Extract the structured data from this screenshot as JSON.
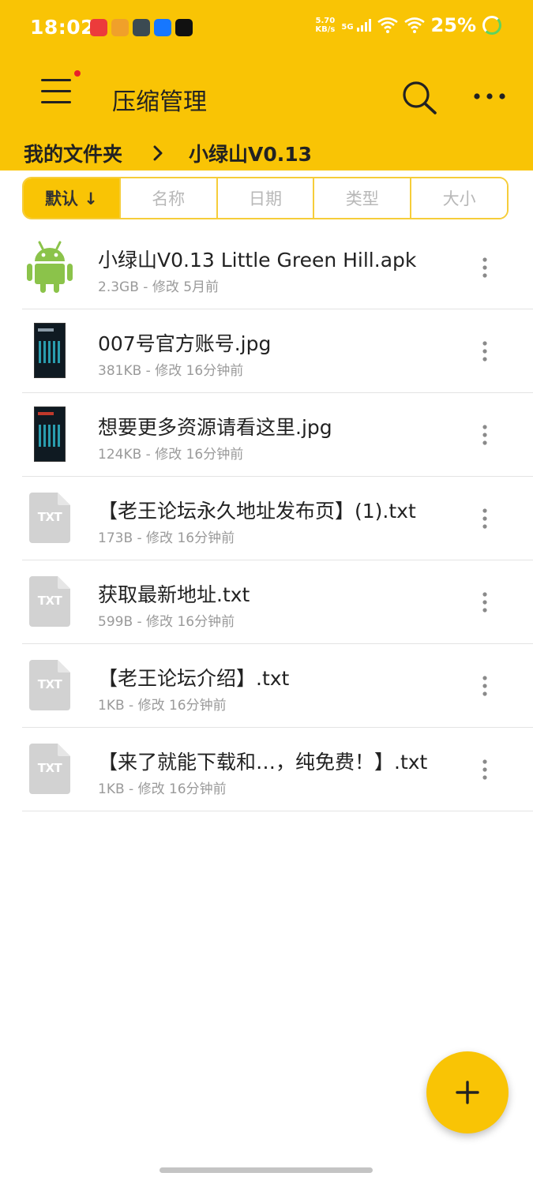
{
  "status_bar": {
    "time": "18:02",
    "net_speed_value": "5.70",
    "net_speed_unit": "KB/s",
    "network_type": "5G",
    "battery": "25%"
  },
  "app_bar": {
    "title": "压缩管理",
    "has_notification_dot": true
  },
  "breadcrumb": {
    "items": [
      "我的文件夹",
      "小绿山V0.13"
    ]
  },
  "sort_tabs": [
    {
      "label": "默认 ↓",
      "active": true
    },
    {
      "label": "名称",
      "active": false
    },
    {
      "label": "日期",
      "active": false
    },
    {
      "label": "类型",
      "active": false
    },
    {
      "label": "大小",
      "active": false
    }
  ],
  "files": [
    {
      "name": "小绿山V0.13 Little Green Hill.apk",
      "meta": "2.3GB - 修改 5月前",
      "icon": "android-icon"
    },
    {
      "name": "007号官方账号.jpg",
      "meta": "381KB - 修改 16分钟前",
      "icon": "image-thumbnail"
    },
    {
      "name": "想要更多资源请看这里.jpg",
      "meta": "124KB - 修改 16分钟前",
      "icon": "image-thumbnail"
    },
    {
      "name": "【老王论坛永久地址发布页】(1).txt",
      "meta": "173B - 修改 16分钟前",
      "icon": "txt-file-icon"
    },
    {
      "name": "获取最新地址.txt",
      "meta": "599B - 修改 16分钟前",
      "icon": "txt-file-icon"
    },
    {
      "name": "【老王论坛介绍】.txt",
      "meta": "1KB - 修改 16分钟前",
      "icon": "txt-file-icon"
    },
    {
      "name": "【来了就能下载和…，纯免费！】.txt",
      "meta": "1KB - 修改 16分钟前",
      "icon": "txt-file-icon"
    }
  ],
  "txt_icon_label": "TXT",
  "colors": {
    "accent": "#F9C405",
    "android_green": "#8BC34A",
    "txt_icon_grey": "#D2D2D2"
  }
}
